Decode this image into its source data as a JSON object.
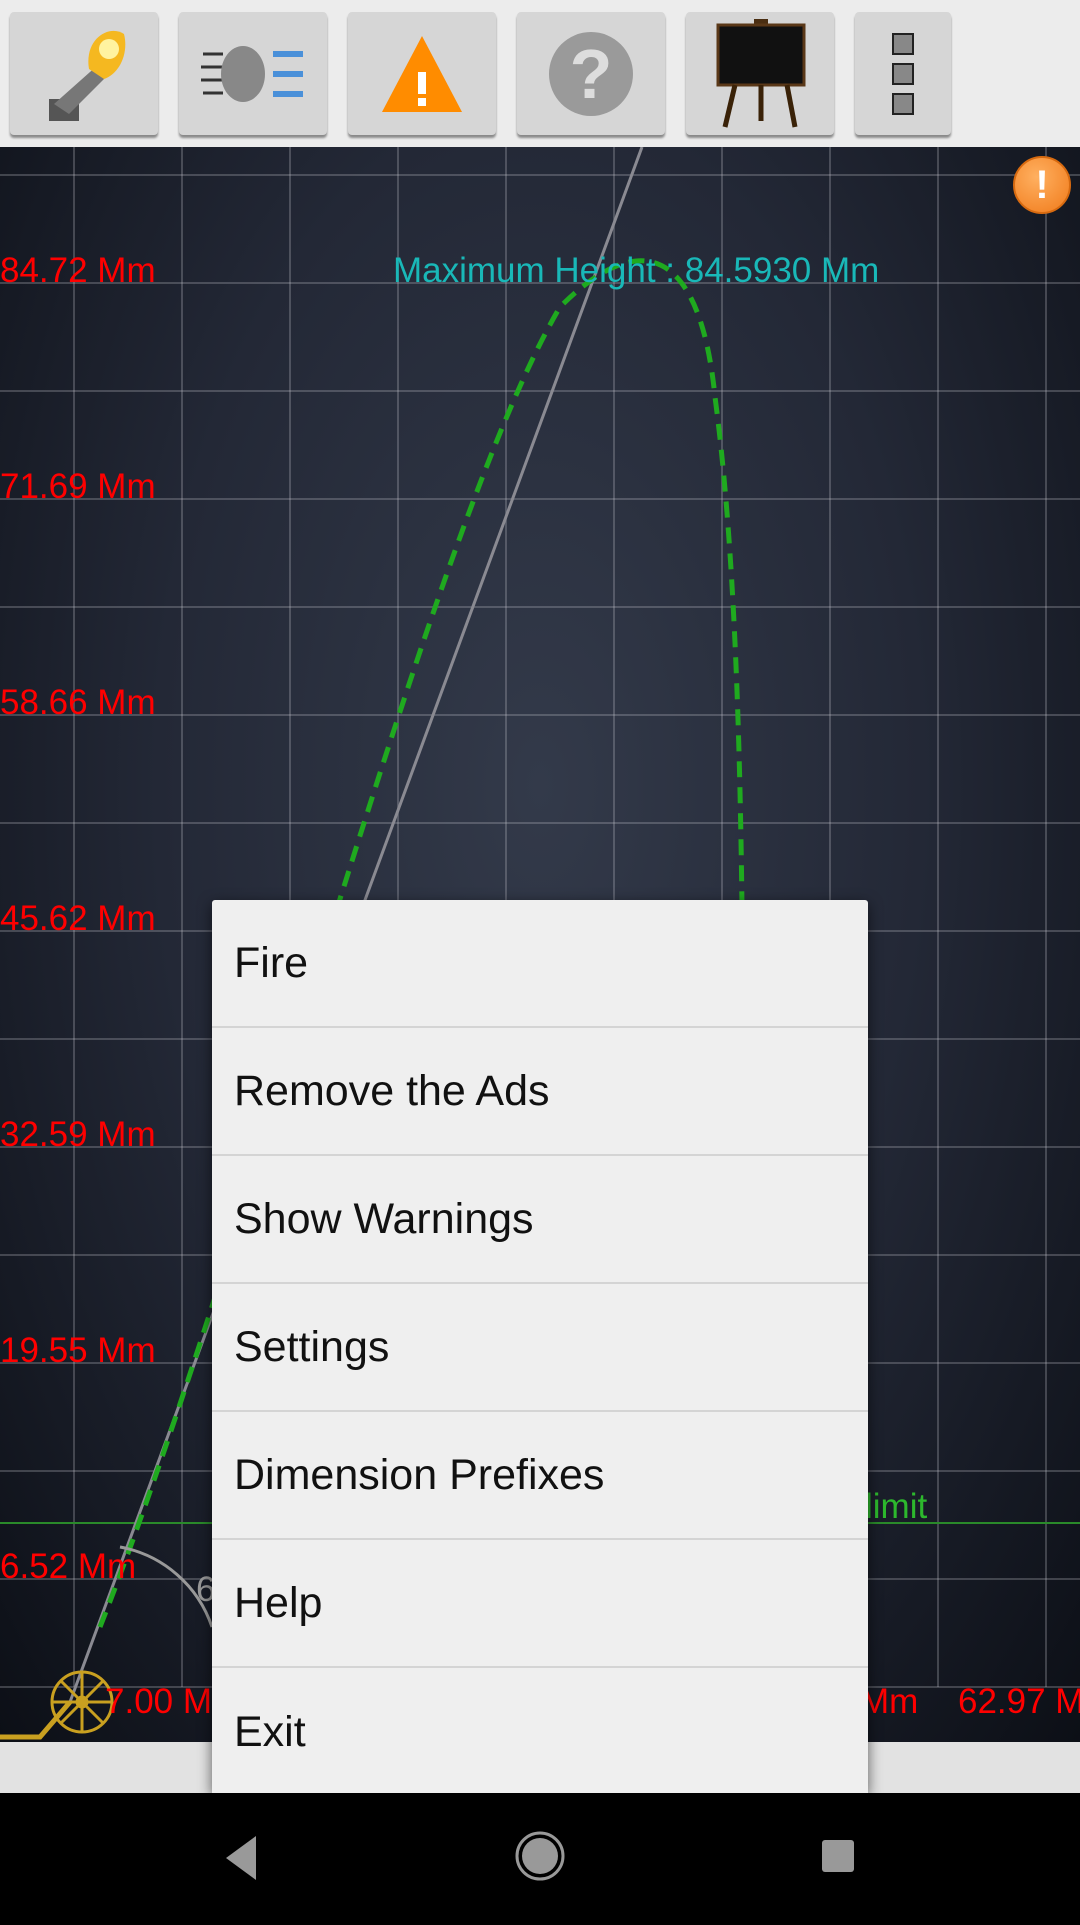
{
  "toolbar": {
    "buttons": [
      {
        "icon": "cannon-fire-icon"
      },
      {
        "icon": "air-resistance-icon"
      },
      {
        "icon": "warning-icon"
      },
      {
        "icon": "help-icon"
      },
      {
        "icon": "blackboard-icon"
      },
      {
        "icon": "overflow-menu-icon"
      }
    ]
  },
  "chart": {
    "y_labels": [
      "84.72 Mm",
      "71.69 Mm",
      "58.66 Mm",
      "45.62 Mm",
      "32.59 Mm",
      "19.55 Mm",
      "6.52 Mm"
    ],
    "x_labels": [
      "7.00 M",
      "Mm",
      "62.97 M"
    ],
    "max_height": "Maximum Height : 84.5930 Mm",
    "limit_label": "limit",
    "angle_label": "6",
    "colors": {
      "axis_labels": "#ff0000",
      "max_height": "#19b8b8",
      "trajectory": "#1faa1f",
      "limit": "#2db82d"
    }
  },
  "warning_badge": "!",
  "menu": {
    "items": [
      "Fire",
      "Remove the Ads",
      "Show Warnings",
      "Settings",
      "Dimension Prefixes",
      "Help",
      "Exit"
    ]
  },
  "navbar": {
    "back": "back-icon",
    "home": "home-icon",
    "recents": "recents-icon"
  }
}
